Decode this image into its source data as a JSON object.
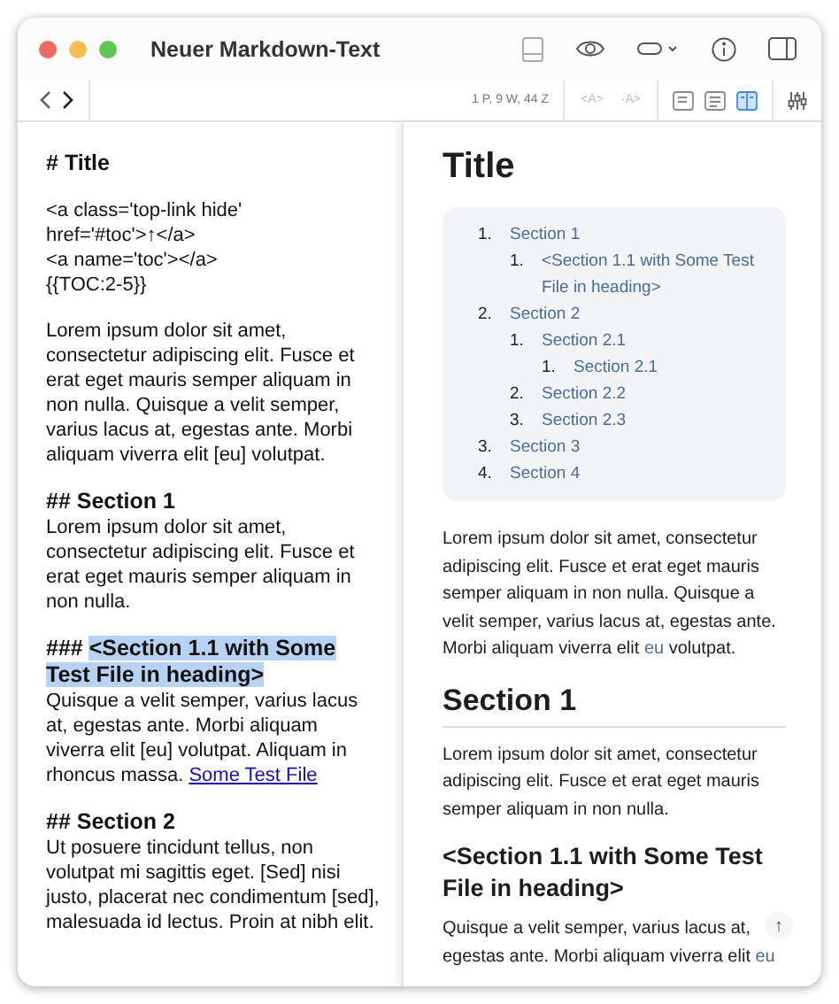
{
  "window": {
    "title": "Neuer Markdown-Text"
  },
  "toolbar": {
    "stats": "1 P, 9 W, 44 Z",
    "font_smaller": {
      "label": "<A>",
      "disabled": true
    },
    "font_bigger": {
      "label": "·A>",
      "disabled": true
    },
    "views": [
      {
        "kind": "editor",
        "selected": false
      },
      {
        "kind": "preview",
        "selected": false
      },
      {
        "kind": "split",
        "selected": true
      }
    ]
  },
  "editor": {
    "blocks": [
      {
        "kind": "heading",
        "marker": "#",
        "text": "Title",
        "selected": false
      },
      {
        "kind": "lines",
        "lines": [
          "<a class='top-link hide' href='#toc'>↑</a>",
          "<a name='toc'></a>",
          "{{TOC:2-5}}"
        ]
      },
      {
        "kind": "paragraph",
        "text": "Lorem ipsum dolor sit amet, consectetur adipiscing elit. Fusce et erat eget mauris semper aliquam in non nulla. Quisque a velit semper, varius lacus at, egestas ante. Morbi aliquam viverra elit [eu] volutpat."
      },
      {
        "kind": "heading",
        "marker": "##",
        "text": "Section 1",
        "selected": false
      },
      {
        "kind": "paragraph",
        "text": "Lorem ipsum dolor sit amet, consectetur adipiscing elit. Fusce et erat eget mauris semper aliquam in non nulla."
      },
      {
        "kind": "heading",
        "marker": "###",
        "text": "<Section 1.1 with Some Test File in heading>",
        "selected": true
      },
      {
        "kind": "paragraph",
        "text": "Quisque a velit semper, varius lacus at, egestas ante. Morbi aliquam viverra elit [eu] volutpat. Aliquam in rhoncus massa.",
        "link": "Some Test File"
      },
      {
        "kind": "heading",
        "marker": "##",
        "text": "Section 2",
        "selected": false
      },
      {
        "kind": "paragraph",
        "text": "Ut posuere tincidunt tellus, non volutpat mi sagittis eget. [Sed] nisi justo, placerat nec condimentum [sed], malesuada id lectus. Proin at nibh elit."
      }
    ]
  },
  "preview": {
    "blocks": [
      {
        "kind": "h1",
        "text": "Title"
      },
      {
        "kind": "toc",
        "items": [
          {
            "marker": "1.",
            "label": "Section 1",
            "children": [
              {
                "marker": "1.",
                "label": "<Section 1.1 with Some Test File in heading>"
              }
            ]
          },
          {
            "marker": "2.",
            "label": "Section 2",
            "children": [
              {
                "marker": "1.",
                "label": "Section 2.1",
                "children": [
                  {
                    "marker": "1.",
                    "label": "Section 2.1"
                  }
                ]
              },
              {
                "marker": "2.",
                "label": "Section 2.2"
              },
              {
                "marker": "3.",
                "label": "Section 2.3"
              }
            ]
          },
          {
            "marker": "3.",
            "label": "Section 3"
          },
          {
            "marker": "4.",
            "label": "Section 4"
          }
        ]
      },
      {
        "kind": "paragraph",
        "parts": [
          {
            "kind": "text",
            "text": "Lorem ipsum dolor sit amet, consectetur adipiscing elit. Fusce et erat eget mauris semper aliquam in non nulla. Quisque a velit semper, varius lacus at, egestas ante. Morbi aliquam viverra elit "
          },
          {
            "kind": "link",
            "text": "eu"
          },
          {
            "kind": "text",
            "text": " volutpat."
          }
        ]
      },
      {
        "kind": "h2",
        "text": "Section 1"
      },
      {
        "kind": "paragraph",
        "parts": [
          {
            "kind": "text",
            "text": "Lorem ipsum dolor sit amet, consectetur adipiscing elit. Fusce et erat eget mauris semper aliquam in non nulla."
          }
        ]
      },
      {
        "kind": "h3",
        "text": "<Section 1.1 with Some Test File in heading>"
      },
      {
        "kind": "paragraph",
        "parts": [
          {
            "kind": "text",
            "text": "Quisque a velit semper, varius lacus at, egestas ante. Morbi aliquam viverra elit "
          },
          {
            "kind": "link",
            "text": "eu"
          }
        ]
      }
    ],
    "top_link": "↑"
  }
}
